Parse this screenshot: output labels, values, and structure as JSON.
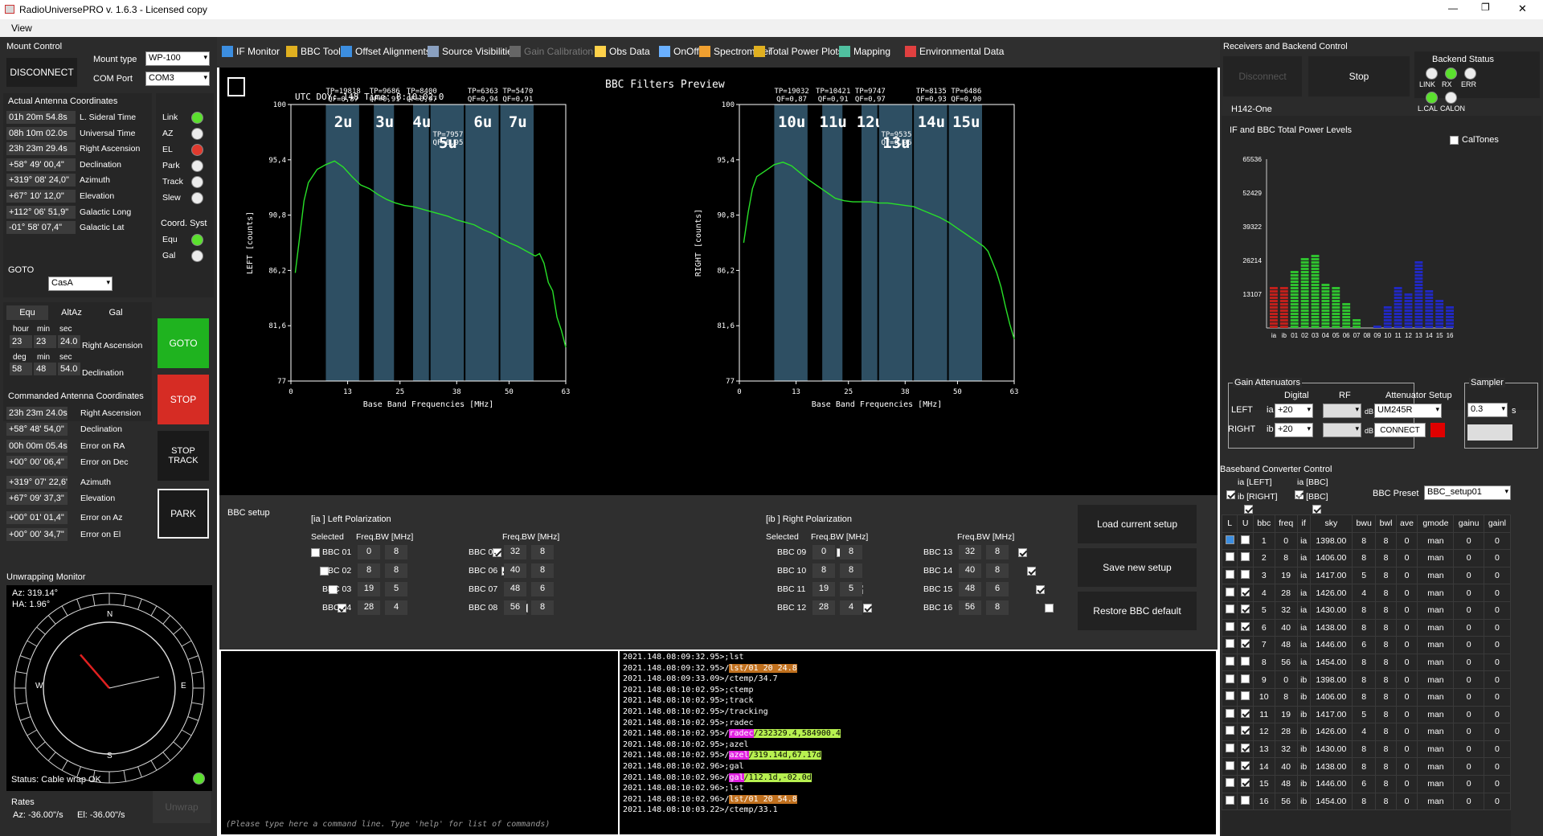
{
  "app": {
    "title": "RadioUniversePRO v. 1.6.3 - Licensed copy",
    "menu": "View"
  },
  "window_controls": {
    "minimize": "—",
    "maximize": "❐",
    "close": "✕"
  },
  "mount": {
    "section": "Mount Control",
    "disconnect": "DISCONNECT",
    "mount_type_label": "Mount type",
    "mount_type": "WP-100",
    "com_port_label": "COM Port",
    "com_port": "COM3",
    "actual_title": "Actual Antenna Coordinates",
    "actual": [
      {
        "value": "01h 20m 54.8s",
        "label": "L. Sideral Time"
      },
      {
        "value": "08h 10m 02.0s",
        "label": "Universal Time"
      },
      {
        "value": "23h 23m 29.4s",
        "label": "Right Ascension"
      },
      {
        "value": "+58° 49' 00,4\"",
        "label": "Declination"
      },
      {
        "value": "+319° 08' 24,0\"",
        "label": "Azimuth"
      },
      {
        "value": "+67° 10' 12,0\"",
        "label": "Elevation"
      },
      {
        "value": "+112° 06' 51,9\"",
        "label": "Galactic Long"
      },
      {
        "value": "-01° 58' 07,4\"",
        "label": "Galactic Lat"
      }
    ],
    "status_leds": [
      {
        "label": "Link",
        "state": "green"
      },
      {
        "label": "AZ",
        "state": "off"
      },
      {
        "label": "EL",
        "state": "red"
      },
      {
        "label": "Park",
        "state": "off"
      },
      {
        "label": "Track",
        "state": "off"
      },
      {
        "label": "Slew",
        "state": "off"
      }
    ],
    "coord_syst_label": "Coord. Syst",
    "coord_leds": [
      {
        "label": "Equ",
        "state": "green"
      },
      {
        "label": "Gal",
        "state": "off"
      }
    ],
    "goto_label": "GOTO",
    "goto_target": "CasA",
    "coord_tabs": [
      "Equ",
      "AltAz",
      "Gal"
    ],
    "hour_label": "hour",
    "min_label": "min",
    "sec_label": "sec",
    "hour": "23",
    "min": "23",
    "sec": "24.0",
    "ra_label": "Right Ascension",
    "deg_label": "deg",
    "dmin_label": "min",
    "dsec_label": "sec",
    "deg": "58",
    "dmin": "48",
    "dsec": "54.0",
    "dec_label": "Declination",
    "commanded_title": "Commanded Antenna Coordinates",
    "commanded": [
      {
        "value": "23h 23m 24.0s",
        "label": "Right Ascension"
      },
      {
        "value": "+58° 48' 54,0\"",
        "label": "Declination"
      },
      {
        "value": "00h 00m 05.4s",
        "label": "Error on RA"
      },
      {
        "value": "+00° 00' 06,4\"",
        "label": "Error on Dec"
      },
      {
        "value": "+319° 07' 22,6\"",
        "label": "Azimuth"
      },
      {
        "value": "+67° 09' 37,3\"",
        "label": "Elevation"
      },
      {
        "value": "+00° 01' 01,4\"",
        "label": "Error on Az"
      },
      {
        "value": "+00° 00' 34,7\"",
        "label": "Error on El"
      }
    ],
    "goto_btn": "GOTO",
    "stop_btn": "STOP",
    "stop_track_btn": "STOP\nTRACK",
    "park_btn": "PARK",
    "goto_color": "#1fb31f",
    "stop_color": "#d62c24"
  },
  "unwrap": {
    "title": "Unwrapping Monitor",
    "az": "Az: 319.14°",
    "ha": "HA: 1.96°",
    "n": "N",
    "e": "E",
    "s": "S",
    "w": "W",
    "status": "Status: Cable wrap OK",
    "rates_title": "Rates",
    "az_rate": "Az: -36.00\"/s",
    "el_rate": "El: -36.00\"/s",
    "unwrap_btn": "Unwrap"
  },
  "tabs": [
    "IF Monitor",
    "BBC Tools",
    "Offset Alignments",
    "Source Visibilities",
    "Gain Calibration",
    "Obs Data",
    "OnOff",
    "Spectrometer",
    "Total Power Plots",
    "Mapping",
    "Environmental Data"
  ],
  "preview": {
    "title": "BBC Filters Preview",
    "utc": "UTC DOY:  148   Time: 8:10:02.0"
  },
  "chart_data": [
    {
      "type": "line",
      "ylabel": "LEFT [counts]",
      "xlabel": "Base Band Frequencies [MHz]",
      "xlim": [
        0,
        63
      ],
      "ylim": [
        77,
        100
      ],
      "xticks": [
        "0",
        "13",
        "25",
        "38",
        "50",
        "63"
      ],
      "yticks": [
        "77",
        "81,6",
        "86,2",
        "90,8",
        "95,4",
        "100"
      ],
      "filters": [
        {
          "name": "2u",
          "from": 8,
          "to": 16,
          "tp": "TP=19818",
          "qf": "QF=0,87"
        },
        {
          "name": "3u",
          "from": 19,
          "to": 24,
          "tp": "TP=9686",
          "qf": "QF=0,91"
        },
        {
          "name": "4u",
          "from": 28,
          "to": 32,
          "tp": "TP=8400",
          "qf": "QF=0,97"
        },
        {
          "name": "5u",
          "from": 32,
          "to": 40,
          "tp": "TP=7957",
          "qf": "QF=0,95"
        },
        {
          "name": "6u",
          "from": 40,
          "to": 48,
          "tp": "TP=6363",
          "qf": "QF=0,94"
        },
        {
          "name": "7u",
          "from": 48,
          "to": 56,
          "tp": "TP=5470",
          "qf": "QF=0,91"
        }
      ],
      "series": [
        {
          "x": [
            1,
            2,
            3,
            4,
            6,
            8,
            10,
            12,
            14,
            16,
            18,
            20,
            22,
            24,
            26,
            28,
            30,
            32,
            34,
            36,
            38,
            40,
            42,
            44,
            46,
            48,
            50,
            52,
            54,
            56,
            57,
            58,
            59,
            60,
            61,
            62,
            63
          ],
          "y": [
            86,
            89,
            92,
            93.5,
            94.6,
            95,
            95.3,
            94.8,
            94,
            93.3,
            93,
            92.5,
            92.1,
            91.8,
            91.6,
            91.5,
            91.3,
            91.1,
            90.9,
            90.7,
            90.4,
            90.2,
            90,
            89.6,
            89.3,
            88.9,
            88.5,
            88.2,
            87.8,
            87.4,
            87.6,
            86.8,
            85.2,
            84.5,
            82.3,
            81.2,
            79.8
          ]
        }
      ]
    },
    {
      "type": "line",
      "ylabel": "RIGHT [counts]",
      "xlabel": "Base Band Frequencies [MHz]",
      "xlim": [
        0,
        63
      ],
      "ylim": [
        77,
        100
      ],
      "xticks": [
        "0",
        "13",
        "25",
        "38",
        "50",
        "63"
      ],
      "yticks": [
        "77",
        "81,6",
        "86,2",
        "90,8",
        "95,4",
        "100"
      ],
      "filters": [
        {
          "name": "10u",
          "from": 8,
          "to": 16,
          "tp": "TP=19032",
          "qf": "QF=0,87"
        },
        {
          "name": "11u",
          "from": 19,
          "to": 24,
          "tp": "TP=10421",
          "qf": "QF=0,91"
        },
        {
          "name": "12u",
          "from": 28,
          "to": 32,
          "tp": "TP=9747",
          "qf": "QF=0,97"
        },
        {
          "name": "13u",
          "from": 32,
          "to": 40,
          "tp": "TP=9535",
          "qf": "QF=0,96"
        },
        {
          "name": "14u",
          "from": 40,
          "to": 48,
          "tp": "TP=8135",
          "qf": "QF=0,93"
        },
        {
          "name": "15u",
          "from": 48,
          "to": 56,
          "tp": "TP=6486",
          "qf": "QF=0,90"
        }
      ],
      "series": [
        {
          "x": [
            1,
            2,
            3,
            4,
            6,
            8,
            10,
            12,
            14,
            16,
            18,
            20,
            22,
            24,
            26,
            28,
            30,
            32,
            34,
            36,
            38,
            40,
            42,
            44,
            46,
            48,
            50,
            52,
            54,
            56,
            57,
            58,
            59,
            60,
            61,
            62,
            63
          ],
          "y": [
            88.5,
            91,
            93,
            94,
            94.5,
            95,
            95.2,
            94.9,
            94.3,
            93.7,
            93.2,
            92.7,
            92.2,
            92,
            91.9,
            91.9,
            91.9,
            91.8,
            91.8,
            91.7,
            91.6,
            91.5,
            91.2,
            90.9,
            90.6,
            90.2,
            89.7,
            89.2,
            88.7,
            88.2,
            87.8,
            86.9,
            86,
            84.8,
            83.2,
            81.7,
            80.5
          ]
        }
      ]
    }
  ],
  "bbc_setup": {
    "title": "BBC setup",
    "left_title": "[ia ] Left Polarization",
    "right_title": "[ib ] Right Polarization",
    "h_selected": "Selected",
    "h_freq": "Freq.",
    "h_bw": "BW [MHz]",
    "left": [
      {
        "name": "BBC 01",
        "on": false,
        "freq": "0",
        "bw": "8"
      },
      {
        "name": "BBC 02",
        "on": false,
        "freq": "8",
        "bw": "8"
      },
      {
        "name": "BBC 03",
        "on": false,
        "freq": "19",
        "bw": "5"
      },
      {
        "name": "BBC 04",
        "on": true,
        "freq": "28",
        "bw": "4"
      },
      {
        "name": "BBC 05",
        "on": true,
        "freq": "32",
        "bw": "8"
      },
      {
        "name": "BBC 06",
        "on": true,
        "freq": "40",
        "bw": "8"
      },
      {
        "name": "BBC 07",
        "on": true,
        "freq": "48",
        "bw": "6"
      },
      {
        "name": "BBC 08",
        "on": false,
        "freq": "56",
        "bw": "8"
      }
    ],
    "right": [
      {
        "name": "BBC 09",
        "on": false,
        "freq": "0",
        "bw": "8"
      },
      {
        "name": "BBC 10",
        "on": false,
        "freq": "8",
        "bw": "8"
      },
      {
        "name": "BBC 11",
        "on": true,
        "freq": "19",
        "bw": "5"
      },
      {
        "name": "BBC 12",
        "on": true,
        "freq": "28",
        "bw": "4"
      },
      {
        "name": "BBC 13",
        "on": true,
        "freq": "32",
        "bw": "8"
      },
      {
        "name": "BBC 14",
        "on": true,
        "freq": "40",
        "bw": "8"
      },
      {
        "name": "BBC 15",
        "on": true,
        "freq": "48",
        "bw": "6"
      },
      {
        "name": "BBC 16",
        "on": false,
        "freq": "56",
        "bw": "8"
      }
    ],
    "load": "Load current setup",
    "save": "Save new setup",
    "restore": "Restore BBC default"
  },
  "console": {
    "placeholder": "(Please type here a command line. Type 'help' for list of commands)",
    "log": [
      {
        "t": "2021.148.08:09:32.95>;lst",
        "h": "",
        "x": ""
      },
      {
        "t": "2021.148.08:09:32.95>/",
        "h": "or",
        "x": "lst/01 20 24.8"
      },
      {
        "t": "2021.148.08:09:33.09>/ctemp/34.7",
        "h": "",
        "x": ""
      },
      {
        "t": "2021.148.08:10:02.95>;ctemp",
        "h": "",
        "x": ""
      },
      {
        "t": "2021.148.08:10:02.95>;track",
        "h": "",
        "x": ""
      },
      {
        "t": "2021.148.08:10:02.95>/tracking",
        "h": "",
        "x": ""
      },
      {
        "t": "2021.148.08:10:02.95>;radec",
        "h": "",
        "x": ""
      },
      {
        "t": "2021.148.08:10:02.95>/",
        "h": "mg",
        "x": "radec",
        "y": "/232329.4,584900.4"
      },
      {
        "t": "2021.148.08:10:02.95>;azel",
        "h": "",
        "x": ""
      },
      {
        "t": "2021.148.08:10:02.95>/",
        "h": "mg",
        "x": "azel",
        "y": "/319.14d,67.17d"
      },
      {
        "t": "2021.148.08:10:02.96>;gal",
        "h": "",
        "x": ""
      },
      {
        "t": "2021.148.08:10:02.96>/",
        "h": "mg",
        "x": "gal",
        "y": "/112.1d,-02.0d"
      },
      {
        "t": "2021.148.08:10:02.96>;lst",
        "h": "",
        "x": ""
      },
      {
        "t": "2021.148.08:10:02.96>/",
        "h": "or",
        "x": "lst/01 20 54.8"
      },
      {
        "t": "2021.148.08:10:03.22>/ctemp/33.1",
        "h": "",
        "x": ""
      }
    ]
  },
  "receivers": {
    "title": "Receivers and Backend Control",
    "disconnect": "Disconnect",
    "stop": "Stop",
    "backend_status": "Backend Status",
    "backend_leds": [
      {
        "label": "LINK",
        "state": "off"
      },
      {
        "label": "RX",
        "state": "green"
      },
      {
        "label": "ERR",
        "state": "off"
      },
      {
        "label": "L.CAL",
        "state": "green"
      },
      {
        "label": "CALON",
        "state": "off"
      }
    ],
    "receiver": "H142-One",
    "power_title": "IF and BBC Total Power Levels",
    "caltones": "CalTones",
    "power_chart": {
      "type": "bar",
      "yticks": [
        "65536",
        "52429",
        "39322",
        "26214",
        "13107"
      ],
      "categories": [
        "ia",
        "ib",
        "01",
        "02",
        "03",
        "04",
        "05",
        "06",
        "07",
        "08",
        "09",
        "10",
        "11",
        "12",
        "13",
        "14",
        "15",
        "16"
      ],
      "values": [
        0.24,
        0.24,
        0.34,
        0.42,
        0.44,
        0.26,
        0.24,
        0.16,
        0.06,
        0.0,
        0.02,
        0.14,
        0.24,
        0.2,
        0.4,
        0.22,
        0.18,
        0.14
      ],
      "colors": [
        "#c0201c",
        "#c0201c",
        "#2fc02f",
        "#2fc02f",
        "#2fc02f",
        "#2fc02f",
        "#2fc02f",
        "#2fc02f",
        "#2fc02f",
        "#2fc02f",
        "#2028c0",
        "#2028c0",
        "#2028c0",
        "#2028c0",
        "#2028c0",
        "#2028c0",
        "#2028c0",
        "#2028c0"
      ]
    },
    "gain_title": "Gain Attenuators",
    "digital": "Digital",
    "rf": "RF",
    "att_setup": "Attenuator Setup",
    "left": "LEFT",
    "ia": "ia",
    "right": "RIGHT",
    "ib": "ib",
    "left_dig": "+20",
    "right_dig": "+20",
    "db1": "dB",
    "db2": "dB",
    "att_model": "UM245R",
    "connect": "CONNECT",
    "sampler": "Sampler",
    "sampler_val": "0.3",
    "s": "s"
  },
  "bbc_ctrl": {
    "title": "Baseband Converter Control",
    "checks": [
      {
        "label": "ia [LEFT]",
        "on": true
      },
      {
        "label": "ia [BBC]",
        "on": true
      },
      {
        "label": "ib [RIGHT]",
        "on": true
      },
      {
        "label": "ib [BBC]",
        "on": true
      }
    ],
    "preset_label": "BBC Preset",
    "preset": "BBC_setup01",
    "headers": [
      "L",
      "U",
      "bbc",
      "freq",
      "if",
      "sky",
      "bwu",
      "bwl",
      "ave",
      "gmode",
      "gainu",
      "gainl"
    ],
    "rows": [
      {
        "l": false,
        "u": false,
        "bbc": "1",
        "freq": "0",
        "if": "ia",
        "sky": "1398.00",
        "bwu": "8",
        "bwl": "8",
        "ave": "0",
        "gmode": "man",
        "gainu": "0",
        "gainl": "0"
      },
      {
        "l": false,
        "u": false,
        "bbc": "2",
        "freq": "8",
        "if": "ia",
        "sky": "1406.00",
        "bwu": "8",
        "bwl": "8",
        "ave": "0",
        "gmode": "man",
        "gainu": "0",
        "gainl": "0"
      },
      {
        "l": false,
        "u": false,
        "bbc": "3",
        "freq": "19",
        "if": "ia",
        "sky": "1417.00",
        "bwu": "5",
        "bwl": "8",
        "ave": "0",
        "gmode": "man",
        "gainu": "0",
        "gainl": "0"
      },
      {
        "l": false,
        "u": true,
        "bbc": "4",
        "freq": "28",
        "if": "ia",
        "sky": "1426.00",
        "bwu": "4",
        "bwl": "8",
        "ave": "0",
        "gmode": "man",
        "gainu": "0",
        "gainl": "0"
      },
      {
        "l": false,
        "u": true,
        "bbc": "5",
        "freq": "32",
        "if": "ia",
        "sky": "1430.00",
        "bwu": "8",
        "bwl": "8",
        "ave": "0",
        "gmode": "man",
        "gainu": "0",
        "gainl": "0"
      },
      {
        "l": false,
        "u": true,
        "bbc": "6",
        "freq": "40",
        "if": "ia",
        "sky": "1438.00",
        "bwu": "8",
        "bwl": "8",
        "ave": "0",
        "gmode": "man",
        "gainu": "0",
        "gainl": "0"
      },
      {
        "l": false,
        "u": true,
        "bbc": "7",
        "freq": "48",
        "if": "ia",
        "sky": "1446.00",
        "bwu": "6",
        "bwl": "8",
        "ave": "0",
        "gmode": "man",
        "gainu": "0",
        "gainl": "0"
      },
      {
        "l": false,
        "u": false,
        "bbc": "8",
        "freq": "56",
        "if": "ia",
        "sky": "1454.00",
        "bwu": "8",
        "bwl": "8",
        "ave": "0",
        "gmode": "man",
        "gainu": "0",
        "gainl": "0"
      },
      {
        "l": false,
        "u": false,
        "bbc": "9",
        "freq": "0",
        "if": "ib",
        "sky": "1398.00",
        "bwu": "8",
        "bwl": "8",
        "ave": "0",
        "gmode": "man",
        "gainu": "0",
        "gainl": "0"
      },
      {
        "l": false,
        "u": false,
        "bbc": "10",
        "freq": "8",
        "if": "ib",
        "sky": "1406.00",
        "bwu": "8",
        "bwl": "8",
        "ave": "0",
        "gmode": "man",
        "gainu": "0",
        "gainl": "0"
      },
      {
        "l": false,
        "u": true,
        "bbc": "11",
        "freq": "19",
        "if": "ib",
        "sky": "1417.00",
        "bwu": "5",
        "bwl": "8",
        "ave": "0",
        "gmode": "man",
        "gainu": "0",
        "gainl": "0"
      },
      {
        "l": false,
        "u": true,
        "bbc": "12",
        "freq": "28",
        "if": "ib",
        "sky": "1426.00",
        "bwu": "4",
        "bwl": "8",
        "ave": "0",
        "gmode": "man",
        "gainu": "0",
        "gainl": "0"
      },
      {
        "l": false,
        "u": true,
        "bbc": "13",
        "freq": "32",
        "if": "ib",
        "sky": "1430.00",
        "bwu": "8",
        "bwl": "8",
        "ave": "0",
        "gmode": "man",
        "gainu": "0",
        "gainl": "0"
      },
      {
        "l": false,
        "u": true,
        "bbc": "14",
        "freq": "40",
        "if": "ib",
        "sky": "1438.00",
        "bwu": "8",
        "bwl": "8",
        "ave": "0",
        "gmode": "man",
        "gainu": "0",
        "gainl": "0"
      },
      {
        "l": false,
        "u": true,
        "bbc": "15",
        "freq": "48",
        "if": "ib",
        "sky": "1446.00",
        "bwu": "6",
        "bwl": "8",
        "ave": "0",
        "gmode": "man",
        "gainu": "0",
        "gainl": "0"
      },
      {
        "l": false,
        "u": false,
        "bbc": "16",
        "freq": "56",
        "if": "ib",
        "sky": "1454.00",
        "bwu": "8",
        "bwl": "8",
        "ave": "0",
        "gmode": "man",
        "gainu": "0",
        "gainl": "0"
      }
    ]
  }
}
